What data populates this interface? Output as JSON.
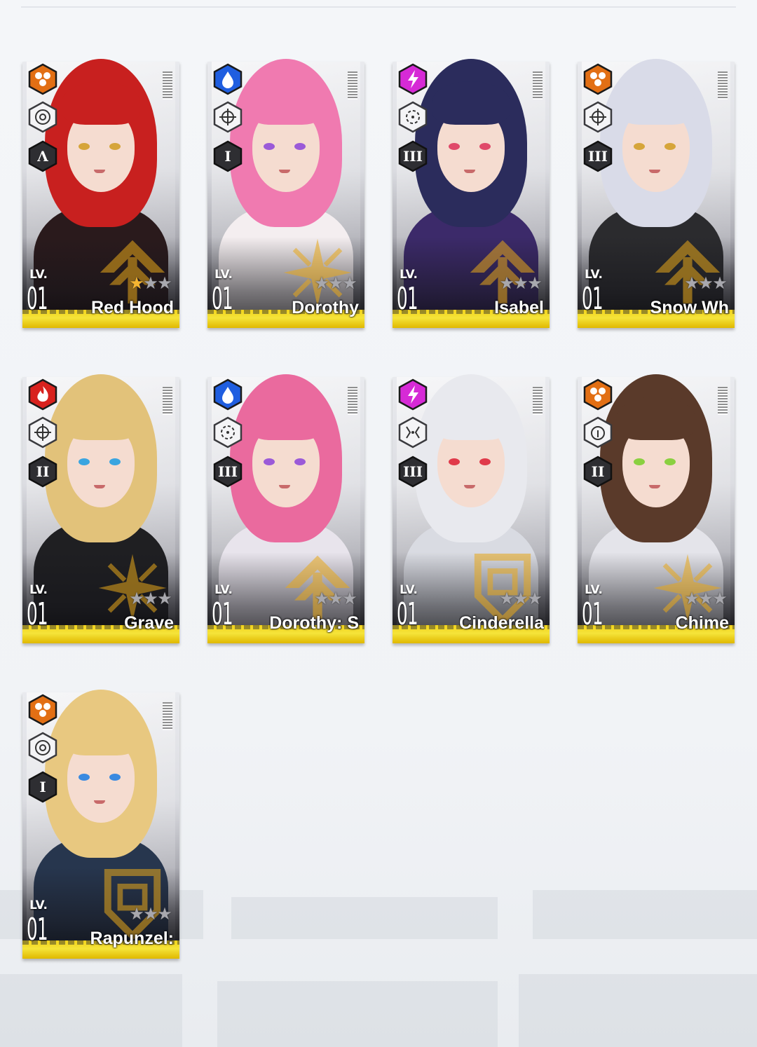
{
  "level_label": "LV.",
  "cards": [
    {
      "name": "Red Hood",
      "level": "01",
      "stars_lit": 1,
      "element": "iron",
      "element_color": "#e26f14",
      "weapon": "sniper-rifle",
      "burst": "Λ",
      "hair": "#c8201f",
      "body": "#2a1a1c",
      "eyes": "#d6a53a",
      "emblem": "attacker"
    },
    {
      "name": "Dorothy",
      "level": "01",
      "stars_lit": 0,
      "element": "water",
      "element_color": "#1f5ee0",
      "weapon": "submachine-gun",
      "burst": "I",
      "hair": "#f07ab0",
      "body": "#f4eef0",
      "eyes": "#9b5ad8",
      "emblem": "supporter"
    },
    {
      "name": "Isabel",
      "level": "01",
      "stars_lit": 0,
      "element": "electric",
      "element_color": "#d62ad6",
      "weapon": "shotgun",
      "burst": "III",
      "hair": "#2b2c5c",
      "body": "#3c2a6a",
      "eyes": "#e04a6a",
      "emblem": "attacker"
    },
    {
      "name": "Snow Wh",
      "level": "01",
      "stars_lit": 0,
      "element": "iron",
      "element_color": "#e26f14",
      "weapon": "submachine-gun",
      "burst": "III",
      "hair": "#d9dbe8",
      "body": "#2b2b2e",
      "eyes": "#d6a53a",
      "emblem": "attacker"
    },
    {
      "name": "Grave",
      "level": "01",
      "stars_lit": 0,
      "element": "fire",
      "element_color": "#d8221e",
      "weapon": "submachine-gun",
      "burst": "II",
      "hair": "#e2c27a",
      "body": "#1f1f22",
      "eyes": "#3aa5e0",
      "emblem": "supporter"
    },
    {
      "name": "Dorothy: S",
      "level": "01",
      "stars_lit": 0,
      "element": "water",
      "element_color": "#1f5ee0",
      "weapon": "shotgun",
      "burst": "III",
      "hair": "#ea6a9e",
      "body": "#e8e4ec",
      "eyes": "#9b5ad8",
      "emblem": "attacker"
    },
    {
      "name": "Cinderella",
      "level": "01",
      "stars_lit": 0,
      "element": "electric",
      "element_color": "#d62ad6",
      "weapon": "rocket-launcher",
      "burst": "III",
      "hair": "#e8e9ee",
      "body": "#d9dbe2",
      "eyes": "#e03a4a",
      "emblem": "defender"
    },
    {
      "name": "Chime",
      "level": "01",
      "stars_lit": 0,
      "element": "iron",
      "element_color": "#e26f14",
      "weapon": "minigun",
      "burst": "II",
      "hair": "#5a3a2a",
      "body": "#e4e4ea",
      "eyes": "#8ad040",
      "emblem": "supporter"
    },
    {
      "name": "Rapunzel:",
      "level": "01",
      "stars_lit": 0,
      "element": "iron",
      "element_color": "#e26f14",
      "weapon": "sniper-rifle",
      "burst": "I",
      "hair": "#e8c880",
      "body": "#27364e",
      "eyes": "#3a8ae0",
      "emblem": "defender"
    }
  ]
}
